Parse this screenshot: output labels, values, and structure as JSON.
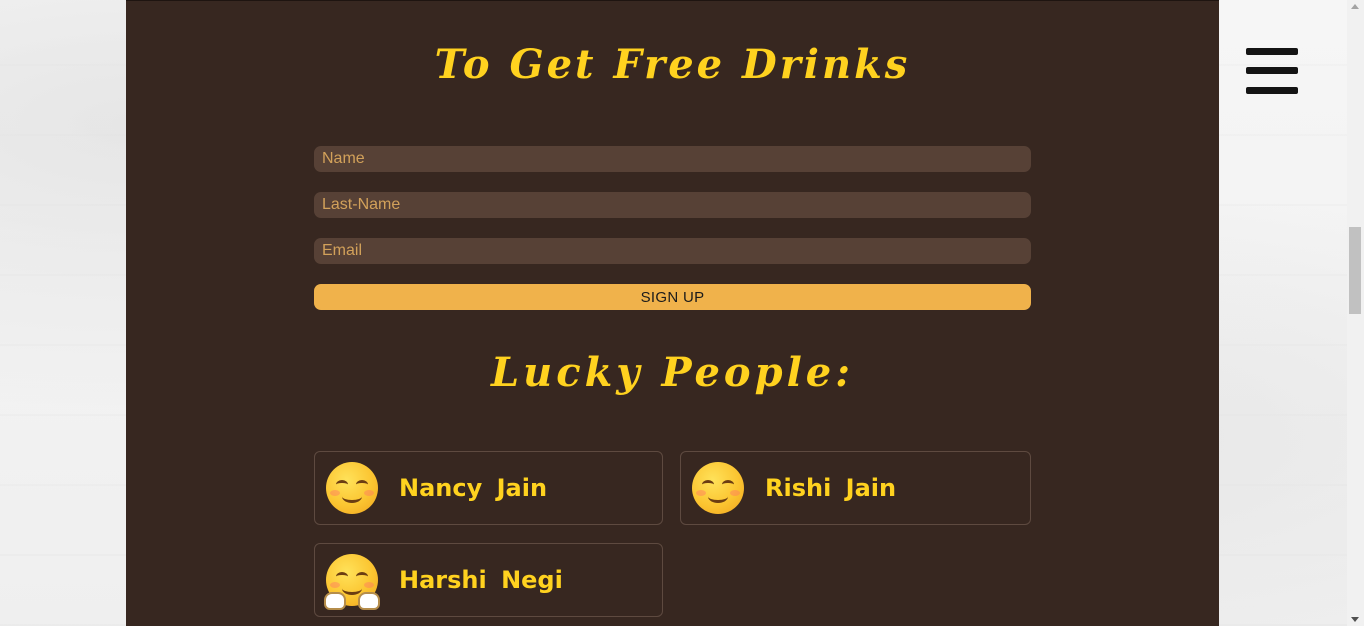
{
  "signup": {
    "title": "To Get Free Drinks",
    "name_placeholder": "Name",
    "lastname_placeholder": "Last-Name",
    "email_placeholder": "Email",
    "button_label": "SIGN UP"
  },
  "lucky": {
    "title": "Lucky People:",
    "people": [
      {
        "name": "Nancy  Jain",
        "icon": "smiling-face-icon"
      },
      {
        "name": "Rishi  Jain",
        "icon": "smiling-face-icon"
      },
      {
        "name": "Harshi  Negi",
        "icon": "hugging-face-icon"
      }
    ]
  },
  "nav": {
    "menu_icon": "hamburger-menu-icon"
  },
  "colors": {
    "panel_bg": "#372720",
    "accent_yellow": "#ffd21f",
    "input_bg": "#574136",
    "button_bg": "#f0b24b"
  }
}
